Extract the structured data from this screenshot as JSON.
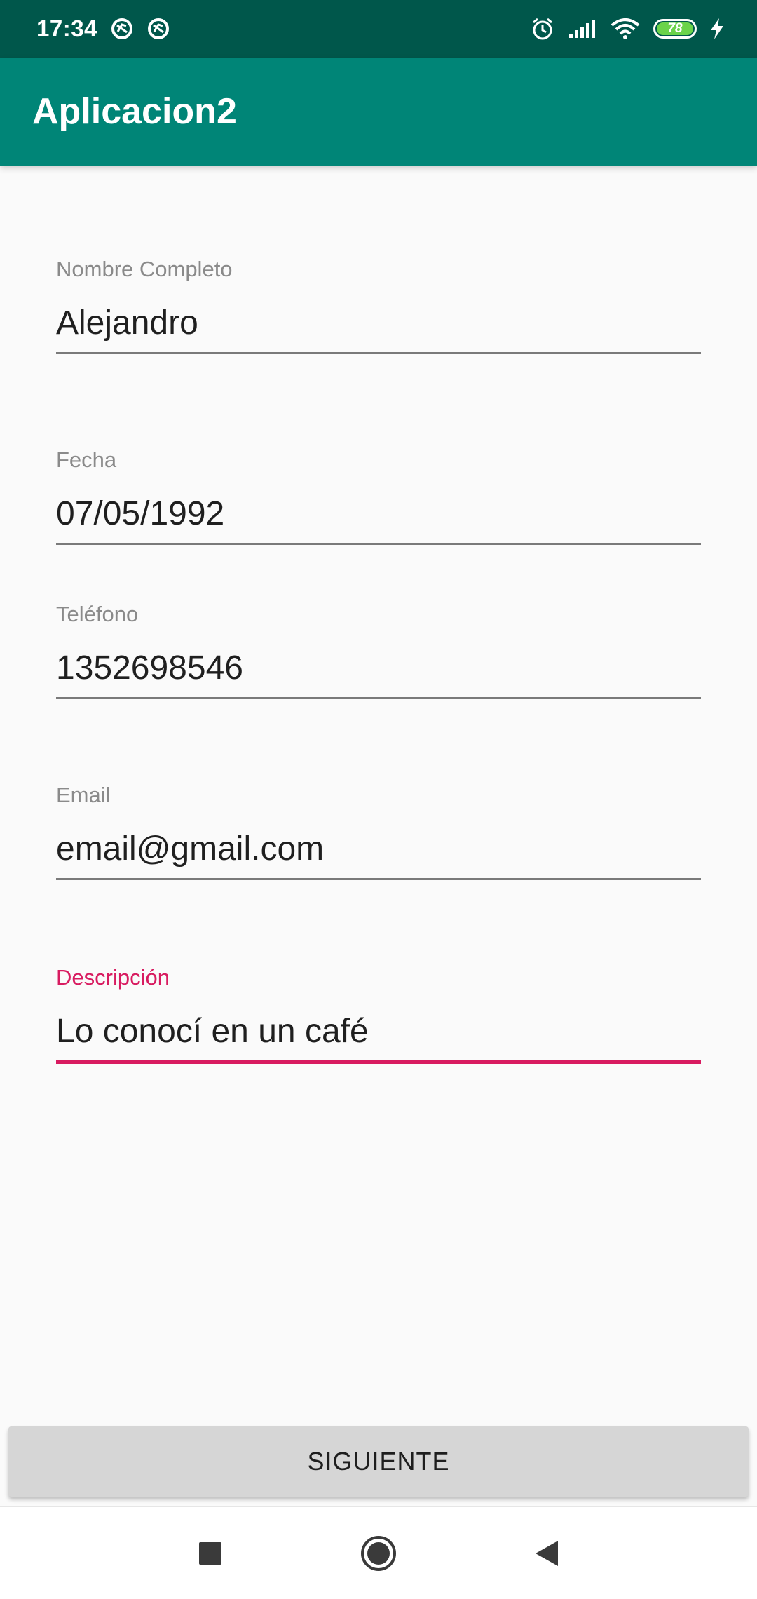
{
  "status_bar": {
    "time": "17:34",
    "battery_level": "78",
    "icons": [
      "sync-icon",
      "sync-icon",
      "alarm-icon",
      "signal-icon",
      "wifi-icon",
      "battery-icon",
      "charging-icon"
    ]
  },
  "app_bar": {
    "title": "Aplicacion2",
    "color": "#008577",
    "status_color": "#00574b"
  },
  "form": {
    "fields": [
      {
        "label": "Nombre Completo",
        "value": "Alejandro",
        "focused": false
      },
      {
        "label": "Fecha",
        "value": "07/05/1992",
        "focused": false
      },
      {
        "label": "Teléfono",
        "value": "1352698546",
        "focused": false
      },
      {
        "label": "Email",
        "value": "email@gmail.com",
        "focused": false
      },
      {
        "label": "Descripción",
        "value": "Lo conocí en un café",
        "focused": true
      }
    ],
    "accent_color": "#d81b60"
  },
  "button": {
    "label": "SIGUIENTE"
  },
  "nav_bar": {
    "icons": [
      "recents-square-icon",
      "home-circle-icon",
      "back-triangle-icon"
    ]
  }
}
